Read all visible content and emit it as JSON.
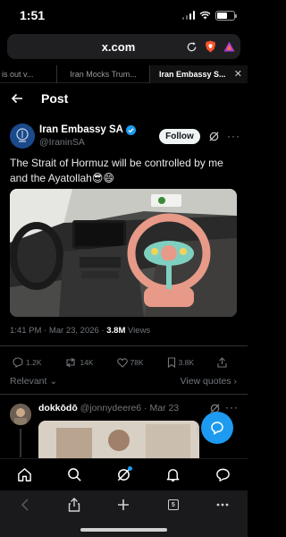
{
  "status": {
    "time": "1:51"
  },
  "browser": {
    "url": "x.com",
    "tabs": [
      {
        "label": "is out v..."
      },
      {
        "label": "Iran Mocks Trum..."
      },
      {
        "label": "Iran Embassy S..."
      }
    ],
    "tab_count": "5"
  },
  "header": {
    "title": "Post"
  },
  "tweet": {
    "display_name": "Iran Embassy SA",
    "handle": "@IraninSA",
    "follow_label": "Follow",
    "text": "The Strait of Hormuz will be controlled by me and the Ayatollah😎😄",
    "timestamp": "1:41 PM · Mar 23, 2026 · ",
    "views_count": "3.8M",
    "views_label": " Views",
    "stats": {
      "replies": "1.2K",
      "reposts": "14K",
      "likes": "78K",
      "bookmarks": "3.8K"
    }
  },
  "sort_label": "Relevant",
  "view_quotes_label": "View quotes",
  "reply": {
    "name": "dokkōdō",
    "handle": "@jonnydeere6 · Mar 23"
  },
  "colors": {
    "accent": "#1d9bf0",
    "background": "#000000",
    "secondary_text": "#71767b"
  },
  "icons": {
    "nav": [
      "home-icon",
      "search-icon",
      "grok-icon",
      "notifications-icon",
      "messages-icon"
    ]
  }
}
